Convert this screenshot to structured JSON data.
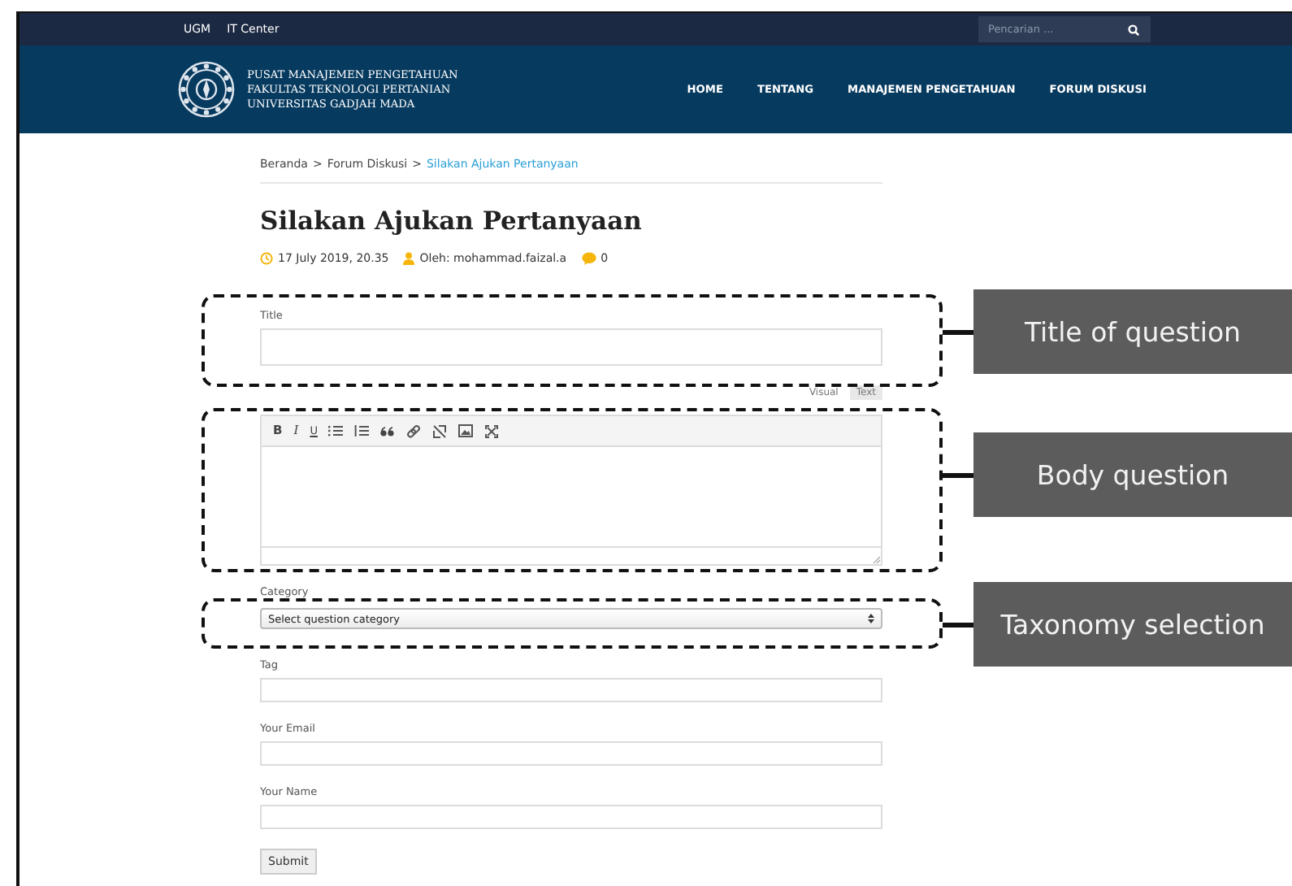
{
  "top_bar": {
    "links": [
      "UGM",
      "IT Center"
    ],
    "search": {
      "placeholder": "Pencarian ..."
    }
  },
  "header": {
    "logo_lines": [
      "PUSAT MANAJEMEN PENGETAHUAN",
      "FAKULTAS TEKNOLOGI PERTANIAN",
      "UNIVERSITAS GADJAH MADA"
    ],
    "nav": [
      {
        "label": "HOME"
      },
      {
        "label": "TENTANG"
      },
      {
        "label": "MANAJEMEN PENGETAHUAN"
      },
      {
        "label": "FORUM DISKUSI"
      }
    ]
  },
  "breadcrumb": {
    "items": [
      "Beranda",
      "Forum Diskusi"
    ],
    "separator": ">",
    "current": "Silakan Ajukan Pertanyaan"
  },
  "title": "Silakan Ajukan Pertanyaan",
  "meta": {
    "date": "17 July 2019, 20.35",
    "author": "Oleh: mohammad.faizal.a",
    "comments": "0"
  },
  "form": {
    "fields": [
      {
        "kind": "text",
        "label": "Title"
      },
      {
        "kind": "editor",
        "tabs": [
          {
            "label": "Visual",
            "selected": false
          },
          {
            "label": "Text",
            "selected": true
          }
        ],
        "toolbar": [
          "B",
          "I",
          "U"
        ]
      },
      {
        "kind": "select",
        "label": "Category",
        "value": "Select question category"
      },
      {
        "kind": "text",
        "label": "Tag"
      },
      {
        "kind": "text",
        "label": "Your Email"
      },
      {
        "kind": "text",
        "label": "Your Name"
      }
    ],
    "submit": "Submit"
  },
  "annotations": [
    {
      "label": "Title of question"
    },
    {
      "label": "Body question"
    },
    {
      "label": "Taxonomy selection"
    }
  ]
}
